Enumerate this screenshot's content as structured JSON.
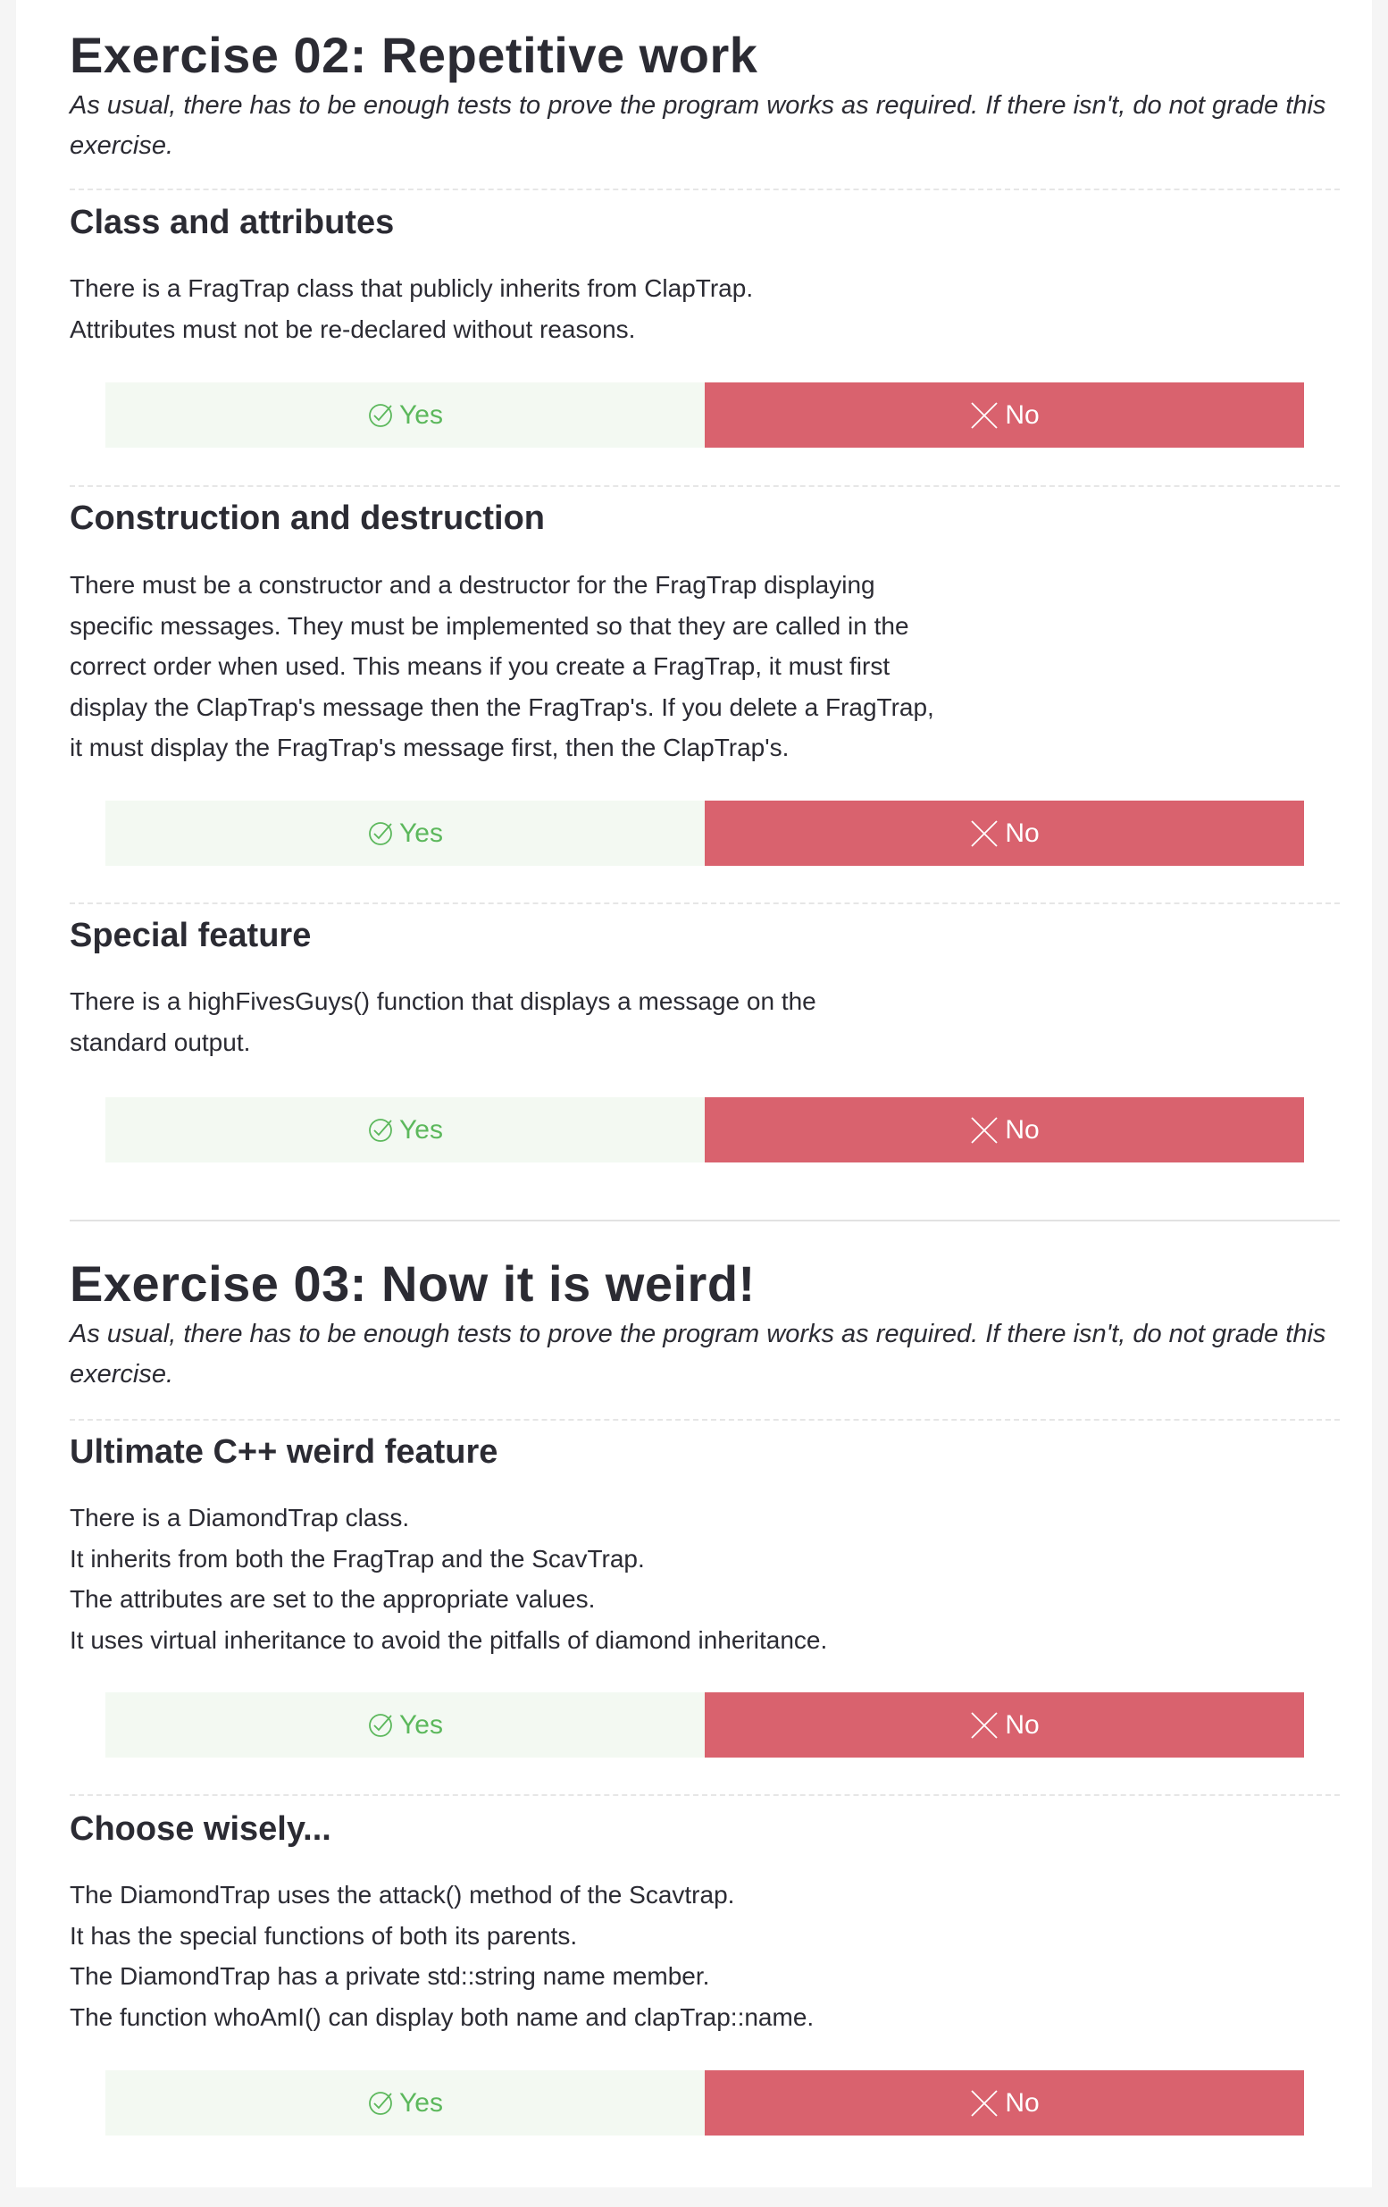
{
  "ex02": {
    "title": "Exercise 02: Repetitive work",
    "subtitle": "As usual, there has to be enough tests to prove the program works as required. If there isn't, do not grade this exercise.",
    "sections": [
      {
        "title": "Class and attributes",
        "text": "There is a FragTrap class that publicly inherits from ClapTrap.\nAttributes must not be re-declared without reasons."
      },
      {
        "title": "Construction and destruction",
        "text": "There must be a constructor and a destructor for the FragTrap displaying\nspecific messages. They must be implemented so that they are called in the\ncorrect order when used. This means if you create a FragTrap, it must first\ndisplay the ClapTrap's message then the FragTrap's. If you delete a FragTrap,\nit must display the FragTrap's message first, then the ClapTrap's."
      },
      {
        "title": "Special feature",
        "text": "There is a highFivesGuys() function that displays a message on the\nstandard output."
      }
    ]
  },
  "ex03": {
    "title": "Exercise 03: Now it is weird!",
    "subtitle": "As usual, there has to be enough tests to prove the program works as required. If there isn't, do not grade this exercise.",
    "sections": [
      {
        "title": "Ultimate C++ weird feature",
        "text": "There is a DiamondTrap class.\nIt inherits from both the FragTrap and the ScavTrap.\nThe attributes are set to the appropriate values.\nIt uses virtual inheritance to avoid the pitfalls of diamond inheritance."
      },
      {
        "title": "Choose wisely...",
        "text": "The DiamondTrap uses the attack() method of the Scavtrap.\nIt has the special functions of both its parents.\nThe DiamondTrap has a private std::string name member.\nThe function whoAmI() can display both name and clapTrap::name."
      }
    ]
  },
  "buttons": {
    "yes_label": "Yes",
    "no_label": "No"
  },
  "colors": {
    "yes_bg": "#f3f9f2",
    "yes_text": "#5cb85c",
    "no_bg": "#d9626e",
    "text": "#2b2b33"
  },
  "icons": {
    "yes": "check-icon",
    "no": "cross-icon"
  }
}
